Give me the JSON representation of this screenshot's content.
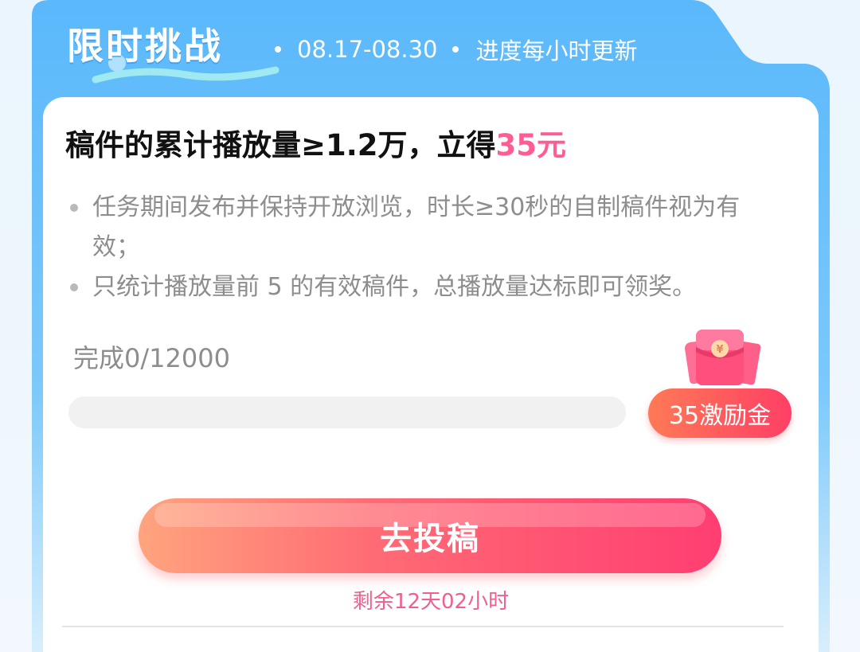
{
  "header": {
    "title": "限时挑战",
    "date_range": "08.17-08.30",
    "update_note": "进度每小时更新"
  },
  "task": {
    "title_main": "稿件的累计播放量≥1.2万，立得",
    "title_reward": "35元",
    "rules": [
      "任务期间发布并保持开放浏览，时长≥30秒的自制稿件视为有效；",
      "只统计播放量前 5 的有效稿件，总播放量达标即可领奖。"
    ]
  },
  "progress": {
    "label": "完成0/12000",
    "fraction": 0,
    "reward_label": "35激励金"
  },
  "cta": {
    "label": "去投稿",
    "countdown": "剩余12天02小时"
  },
  "colors": {
    "header_blue": "#5ab8fb",
    "accent_pink": "#ff5c93",
    "button_gradient_start": "#ffa47e",
    "button_gradient_end": "#ff3e72"
  },
  "icons": {
    "reward": "red-envelope-icon"
  }
}
